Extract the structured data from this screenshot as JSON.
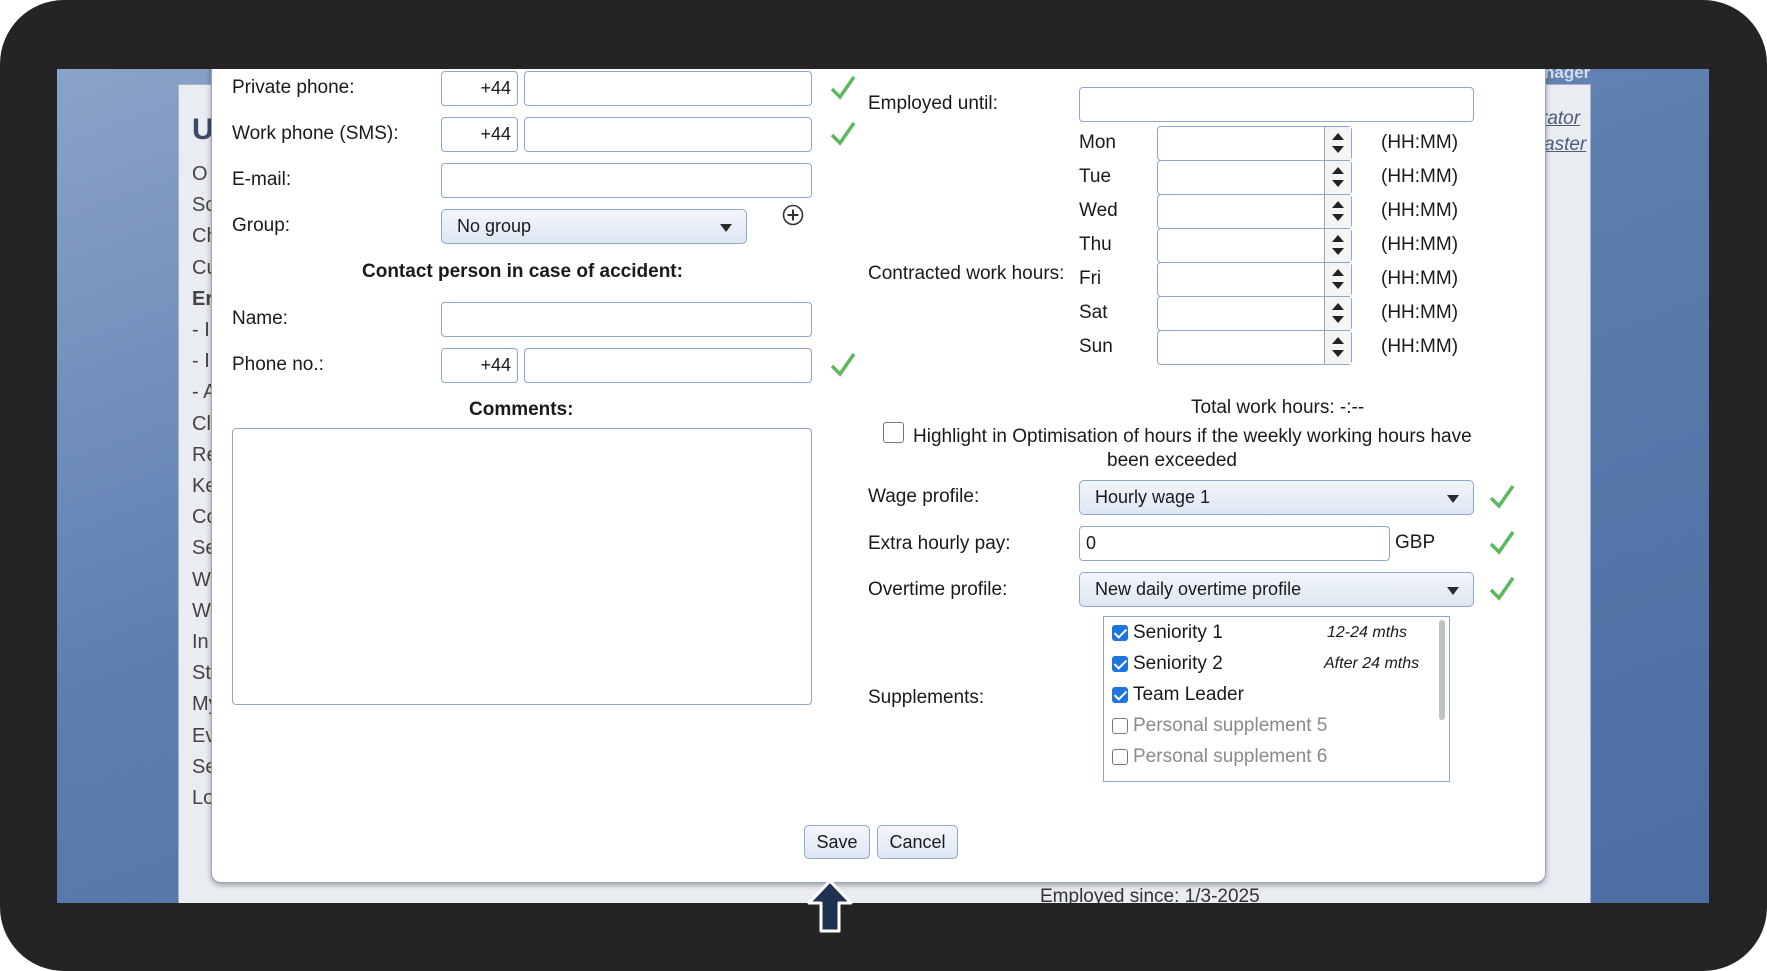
{
  "background": {
    "title_letter": "U",
    "sidebar_letters": [
      "O",
      "Sc",
      "Ch",
      "Cu",
      "Er",
      "- I",
      "- I",
      "- A",
      "Cl",
      "Re",
      "Ke",
      "Co",
      "Se",
      "W",
      "W",
      "In",
      "St",
      "My",
      "Ev",
      "Se",
      "Lo"
    ],
    "top_right_text": "nager",
    "right_link_1": "rator",
    "right_link_2": "aster",
    "bottom_text": "Employed since: 1/3-2025"
  },
  "form": {
    "private_phone": {
      "label": "Private phone:",
      "prefix": "+44",
      "value": ""
    },
    "work_phone": {
      "label": "Work phone (SMS):",
      "prefix": "+44",
      "value": ""
    },
    "email": {
      "label": "E-mail:",
      "value": ""
    },
    "group": {
      "label": "Group:",
      "selected": "No group"
    },
    "contact_heading": "Contact person in case of accident:",
    "contact_name": {
      "label": "Name:",
      "value": ""
    },
    "contact_phone": {
      "label": "Phone no.:",
      "prefix": "+44",
      "value": ""
    },
    "comments": {
      "label": "Comments:",
      "value": ""
    },
    "employed_until": {
      "label": "Employed until:",
      "value": ""
    },
    "contracted_label": "Contracted work hours:",
    "days": [
      {
        "day": "Mon",
        "value": "",
        "unit": "(HH:MM)"
      },
      {
        "day": "Tue",
        "value": "",
        "unit": "(HH:MM)"
      },
      {
        "day": "Wed",
        "value": "",
        "unit": "(HH:MM)"
      },
      {
        "day": "Thu",
        "value": "",
        "unit": "(HH:MM)"
      },
      {
        "day": "Fri",
        "value": "",
        "unit": "(HH:MM)"
      },
      {
        "day": "Sat",
        "value": "",
        "unit": "(HH:MM)"
      },
      {
        "day": "Sun",
        "value": "",
        "unit": "(HH:MM)"
      }
    ],
    "total_hours": "Total work hours: -:--",
    "highlight_line1": "Highlight in Optimisation of hours if the weekly working hours have",
    "highlight_line2": "been exceeded",
    "highlight_checked": false,
    "wage_profile": {
      "label": "Wage profile:",
      "selected": "Hourly wage 1"
    },
    "extra_pay": {
      "label": "Extra hourly pay:",
      "value": "0",
      "currency": "GBP"
    },
    "overtime_profile": {
      "label": "Overtime profile:",
      "selected": "New daily overtime profile"
    },
    "supplements_label": "Supplements:",
    "supplements": [
      {
        "name": "Seniority 1",
        "note": "12-24 mths",
        "checked": true
      },
      {
        "name": "Seniority 2",
        "note": "After 24 mths",
        "checked": true
      },
      {
        "name": "Team Leader",
        "note": "",
        "checked": true
      },
      {
        "name": "Personal supplement 5",
        "note": "",
        "checked": false
      },
      {
        "name": "Personal supplement 6",
        "note": "",
        "checked": false
      }
    ]
  },
  "buttons": {
    "save": "Save",
    "cancel": "Cancel"
  },
  "colors": {
    "check_green": "#5cb85c",
    "checkbox_blue": "#1f75e0",
    "input_border": "#8ea7cc"
  }
}
